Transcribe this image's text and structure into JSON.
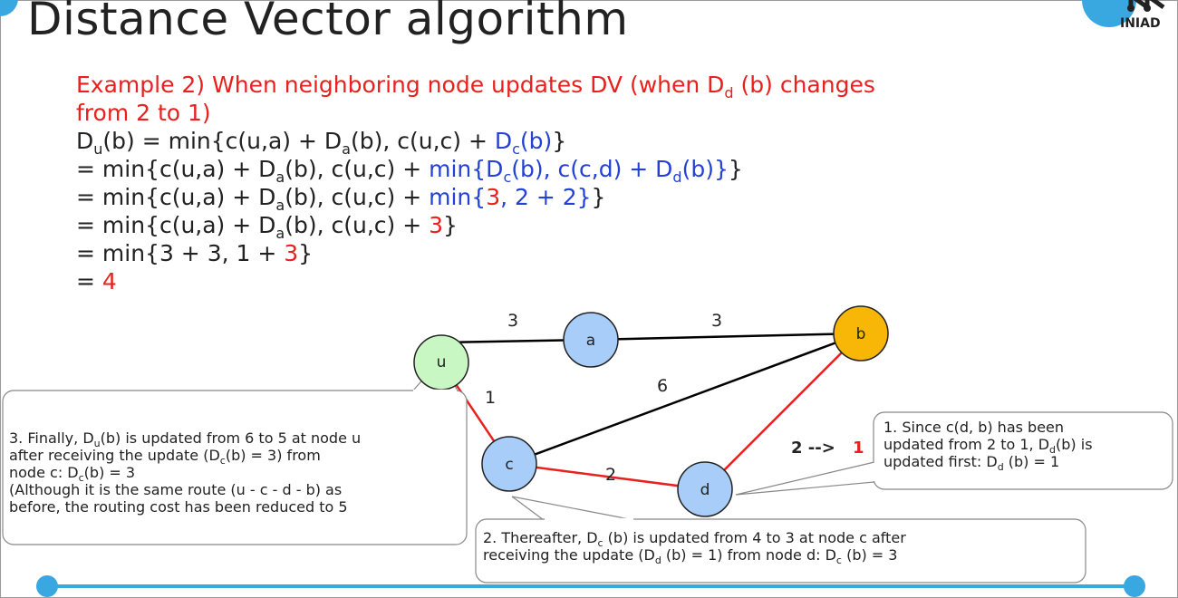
{
  "slide": {
    "title": "Distance Vector algorithm",
    "logo_text": "INIAD"
  },
  "example": {
    "prefix": "Example 2) When neighboring node updates DV (when D",
    "sub_d": "d",
    "suffix": " (b) changes from 2 to 1)"
  },
  "equations": {
    "line1": {
      "a": "D",
      "a_sub": "u",
      "b": "(b) = min{c(u,a) + D",
      "b_sub": "a",
      "c": "(b), c(u,c) + ",
      "d": "D",
      "d_sub": "c",
      "e": "(b)",
      "f": "}"
    },
    "line2": {
      "a": " = min{c(u,a) + D",
      "a_sub": "a",
      "b": "(b), c(u,c) + ",
      "c": "min{D",
      "c_sub": "c",
      "d": "(b), c(c,d) + D",
      "d_sub": "d",
      "e": "(b)}",
      "f": "}"
    },
    "line3": {
      "a": " = min{c(u,a) + D",
      "a_sub": "a",
      "b": "(b), c(u,c) + ",
      "c": "min{",
      "d": "3",
      "e": ", 2 + 2}",
      "f": "}"
    },
    "line4": {
      "a": " = min{c(u,a) + D",
      "a_sub": "a",
      "b": "(b), c(u,c) + ",
      "c": "3",
      "d": "}"
    },
    "line5": {
      "a": " = min{3 + 3, 1 + ",
      "b": "3",
      "c": "}"
    },
    "line6": {
      "a": " = ",
      "b": "4"
    }
  },
  "graph": {
    "nodes": {
      "u": "u",
      "a": "a",
      "b": "b",
      "c": "c",
      "d": "d"
    },
    "edge_labels": {
      "ua": "3",
      "ab": "3",
      "cb": "6",
      "uc": "1",
      "cd": "2"
    },
    "update_label": {
      "from": "2 -->",
      "to": "1"
    },
    "colors": {
      "default_node": "#a7cdf8",
      "u_node": "#c9f7c3",
      "b_node": "#f8b706",
      "highlight": "#e8201e",
      "edge": "#000000"
    }
  },
  "callouts": {
    "c1": {
      "l1": "1. Since c(d, b) has been",
      "l2a": "updated from 2 to 1, D",
      "l2sub": "d",
      "l2b": "(b) is",
      "l3a": "updated first: D",
      "l3sub": "d",
      "l3b": " (b) = 1"
    },
    "c2": {
      "l1a": "2. Thereafter, D",
      "l1sub": "c",
      "l1b": " (b) is updated from 4 to 3 at node c after",
      "l2a": "receiving the update (D",
      "l2sub": "d",
      "l2b": " (b) = 1) from node d: D",
      "l2sub2": "c",
      "l2c": " (b) = 3"
    },
    "c3": {
      "l1a": "3. Finally, D",
      "l1sub": "u",
      "l1b": "(b) is updated from 6 to 5 at node u",
      "l2a": "after receiving the update (D",
      "l2sub": "c",
      "l2b": "(b) = 3) from",
      "l3a": "node c: D",
      "l3sub": "c",
      "l3b": "(b) = 3",
      "l4": "(Although it is the same route (u - c - d - b) as",
      "l5": "before, the routing cost has been reduced to 5"
    }
  }
}
